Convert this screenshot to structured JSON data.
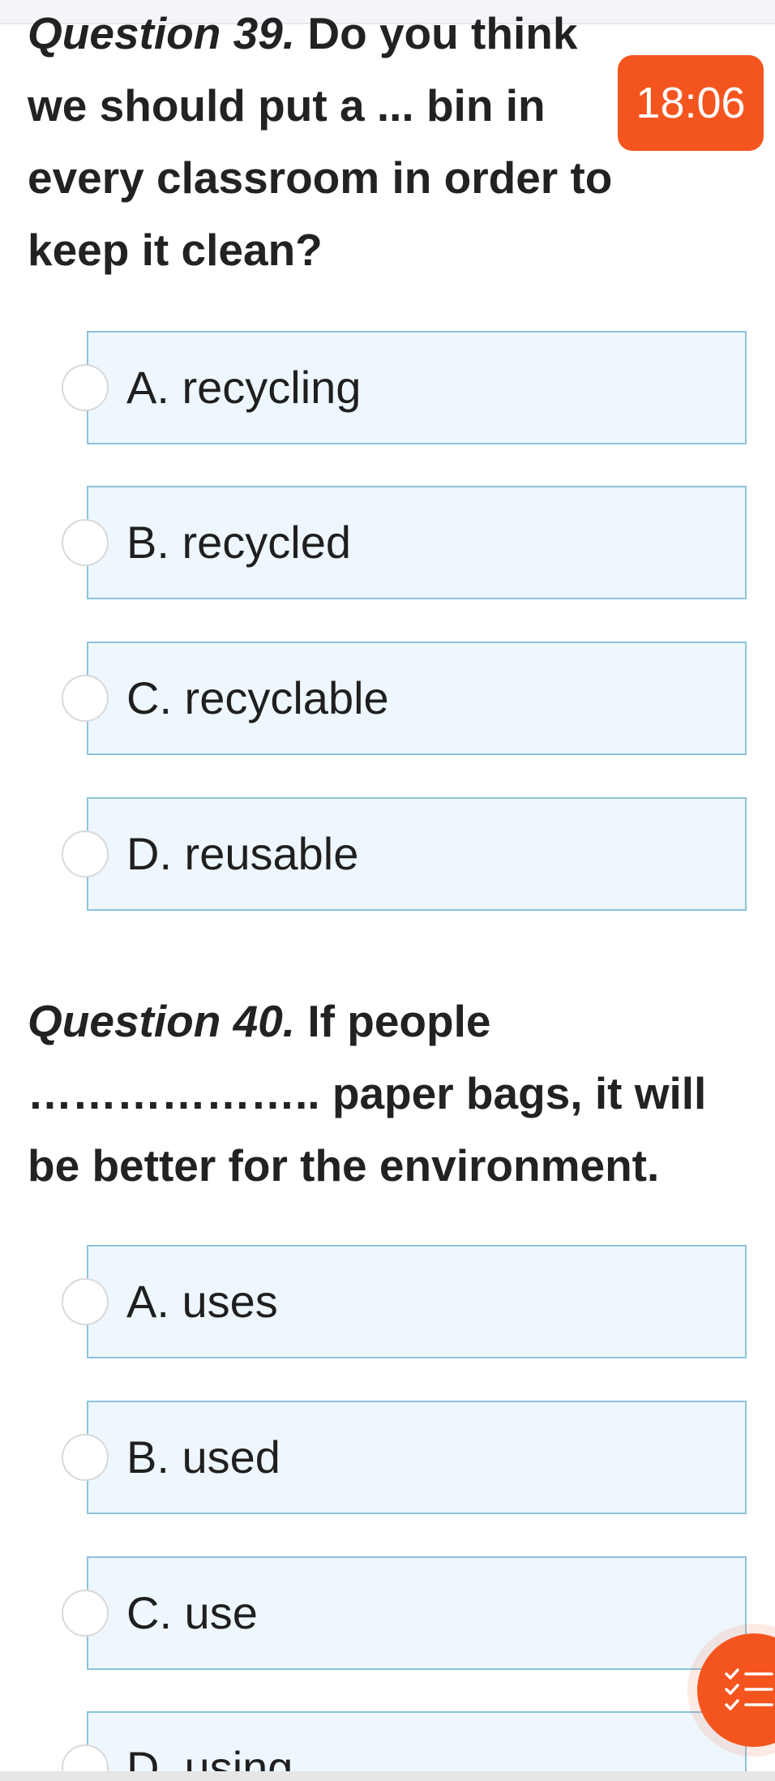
{
  "timer": {
    "value": "18:06"
  },
  "questions": [
    {
      "label": "Question 39.",
      "text": " Do you think we should put a ... bin in every classroom in order to keep it clean?",
      "options": [
        "A. recycling",
        "B. recycled",
        "C. recyclable",
        "D. reusable"
      ]
    },
    {
      "label": "Question 40.",
      "text": " If people ……………….. paper bags, it will be better for the environment.",
      "options": [
        "A. uses",
        "B. used",
        "C. use",
        "D. using"
      ]
    }
  ],
  "icons": {
    "question_list": "checklist-icon",
    "option_marker": "radio-circle-icon"
  },
  "colors": {
    "accent": "#f4551f",
    "option_background": "#eef7fd",
    "option_border": "#8cc3dc",
    "text": "#222222"
  }
}
